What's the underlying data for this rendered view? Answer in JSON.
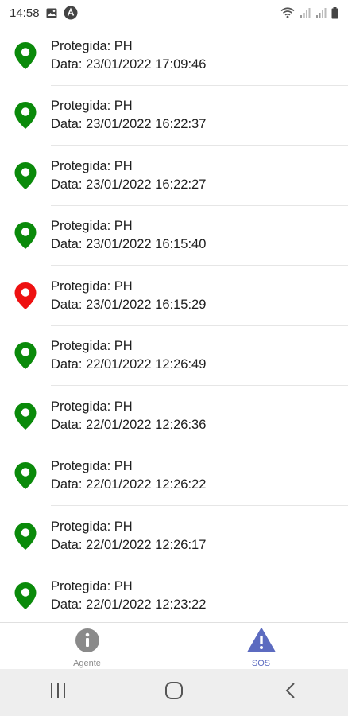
{
  "status_bar": {
    "time": "14:58",
    "icons": [
      "image-icon",
      "app-icon",
      "wifi-icon",
      "signal-icon",
      "signal-icon",
      "battery-icon"
    ]
  },
  "colors": {
    "pin_green": "#0a8a0a",
    "pin_red": "#ee1111",
    "nav_active": "#5c6bc0",
    "nav_inactive": "#8a8a8a"
  },
  "events": [
    {
      "protected": "Protegida: PH",
      "date": "Data: 23/01/2022 17:09:46",
      "pin": "green"
    },
    {
      "protected": "Protegida: PH",
      "date": "Data: 23/01/2022 16:22:37",
      "pin": "green"
    },
    {
      "protected": "Protegida: PH",
      "date": "Data: 23/01/2022 16:22:27",
      "pin": "green"
    },
    {
      "protected": "Protegida: PH",
      "date": "Data: 23/01/2022 16:15:40",
      "pin": "green"
    },
    {
      "protected": "Protegida: PH",
      "date": "Data: 23/01/2022 16:15:29",
      "pin": "red"
    },
    {
      "protected": "Protegida: PH",
      "date": "Data: 22/01/2022 12:26:49",
      "pin": "green"
    },
    {
      "protected": "Protegida: PH",
      "date": "Data: 22/01/2022 12:26:36",
      "pin": "green"
    },
    {
      "protected": "Protegida: PH",
      "date": "Data: 22/01/2022 12:26:22",
      "pin": "green"
    },
    {
      "protected": "Protegida: PH",
      "date": "Data: 22/01/2022 12:26:17",
      "pin": "green"
    },
    {
      "protected": "Protegida: PH",
      "date": "Data: 22/01/2022 12:23:22",
      "pin": "green"
    }
  ],
  "bottom_nav": {
    "items": [
      {
        "label": "Agente",
        "icon": "info-icon",
        "active": false
      },
      {
        "label": "SOS",
        "icon": "warning-icon",
        "active": true
      }
    ]
  },
  "system_nav": {
    "buttons": [
      "recents-icon",
      "home-icon",
      "back-icon"
    ]
  }
}
